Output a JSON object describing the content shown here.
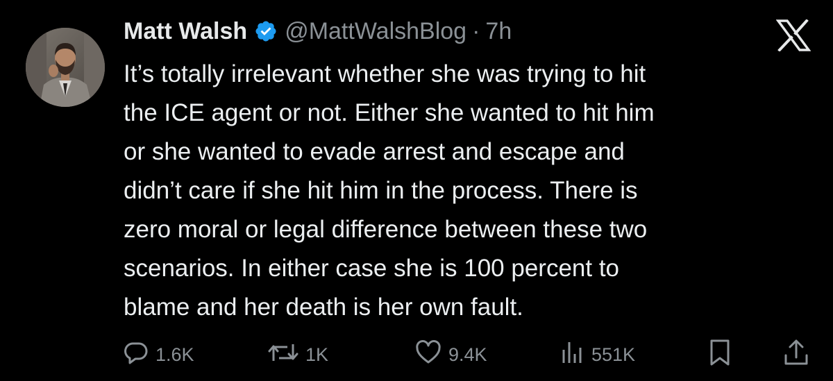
{
  "tweet": {
    "author": {
      "display_name": "Matt Walsh",
      "verified": true,
      "handle": "@MattWalshBlog",
      "separator": "·",
      "time": "7h"
    },
    "text": "It’s totally irrelevant whether she was trying to hit\nthe ICE agent or not. Either she wanted to hit him\nor she wanted to evade arrest and escape and\ndidn’t care if she hit him in the process. There is\nzero moral or legal difference between these two\nscenarios. In either case she is 100 percent to\nblame and her death is her own fault.",
    "stats": {
      "replies": "1.6K",
      "reposts": "1K",
      "likes": "9.4K",
      "views": "551K"
    }
  },
  "icons": {
    "platform_logo": "x-logo-icon",
    "verified": "verified-badge-icon",
    "reply": "reply-icon",
    "repost": "repost-icon",
    "like": "heart-icon",
    "views": "views-chart-icon",
    "bookmark": "bookmark-icon",
    "share": "share-icon"
  },
  "colors": {
    "background": "#000000",
    "text": "#e7e9ea",
    "secondary_text": "#8b9196",
    "verified": "#1d9bf0"
  }
}
